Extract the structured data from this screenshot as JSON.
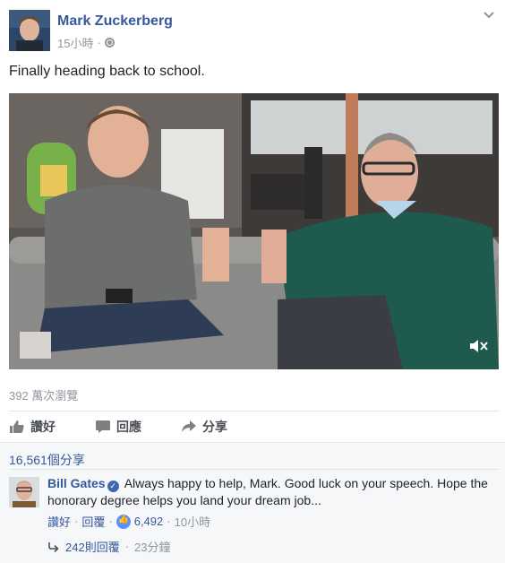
{
  "post": {
    "author": "Mark Zuckerberg",
    "time": "15小時",
    "separator": "·",
    "privacy_icon": "globe-icon",
    "text": "Finally heading back to school.",
    "views": "392 萬次瀏覽"
  },
  "actions": {
    "like_label": "讚好",
    "comment_label": "回應",
    "share_label": "分享"
  },
  "shares": "16,561個分享",
  "comment": {
    "author": "Bill Gates",
    "text": "Always happy to help, Mark. Good luck on your speech. Hope the honorary degree helps you land your dream job...",
    "like_label": "讚好",
    "separator": "·",
    "reply_label": "回覆",
    "like_count": "6,492",
    "time": "10小時"
  },
  "replies": {
    "label": "242則回覆",
    "separator": "·",
    "time": "23分鐘"
  },
  "colors": {
    "link": "#365899",
    "muted": "#90949c",
    "comments_bg": "#f6f7f9"
  }
}
